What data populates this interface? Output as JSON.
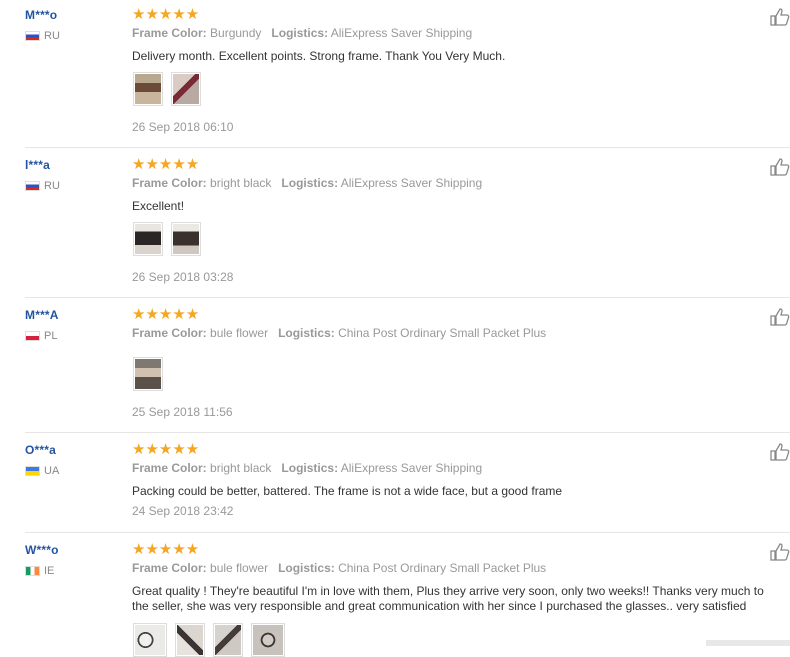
{
  "labels": {
    "frame_color": "Frame Color:",
    "logistics": "Logistics:"
  },
  "reviews": [
    {
      "user": "M***o",
      "country": "RU",
      "stars": "★★★★★",
      "frame_color": "Burgundy",
      "logistics": "AliExpress Saver Shipping",
      "text": "Delivery month. Excellent points. Strong frame. Thank You Very Much.",
      "date": "26 Sep 2018 06:10"
    },
    {
      "user": "l***a",
      "country": "RU",
      "stars": "★★★★★",
      "frame_color": "bright black",
      "logistics": "AliExpress Saver Shipping",
      "text": "Excellent!",
      "date": "26 Sep 2018 03:28"
    },
    {
      "user": "M***A",
      "country": "PL",
      "stars": "★★★★★",
      "frame_color": "bule flower",
      "logistics": "China Post Ordinary Small Packet Plus",
      "text": "",
      "date": "25 Sep 2018 11:56"
    },
    {
      "user": "O***a",
      "country": "UA",
      "stars": "★★★★★",
      "frame_color": "bright black",
      "logistics": "AliExpress Saver Shipping",
      "text": "Packing could be better, battered. The frame is not a wide face, but a good frame",
      "date": "24 Sep 2018 23:42"
    },
    {
      "user": "W***o",
      "country": "IE",
      "stars": "★★★★★",
      "frame_color": "bule flower",
      "logistics": "China Post Ordinary Small Packet Plus",
      "text": "Great quality ! They're beautiful I'm in love with them, Plus they arrive very soon, only two weeks!! Thanks very much to the seller, she was very responsible and great communication with her since I purchased the glasses.. very satisfied",
      "date": ""
    }
  ],
  "icons": {
    "like": "thumbs-up-icon"
  }
}
